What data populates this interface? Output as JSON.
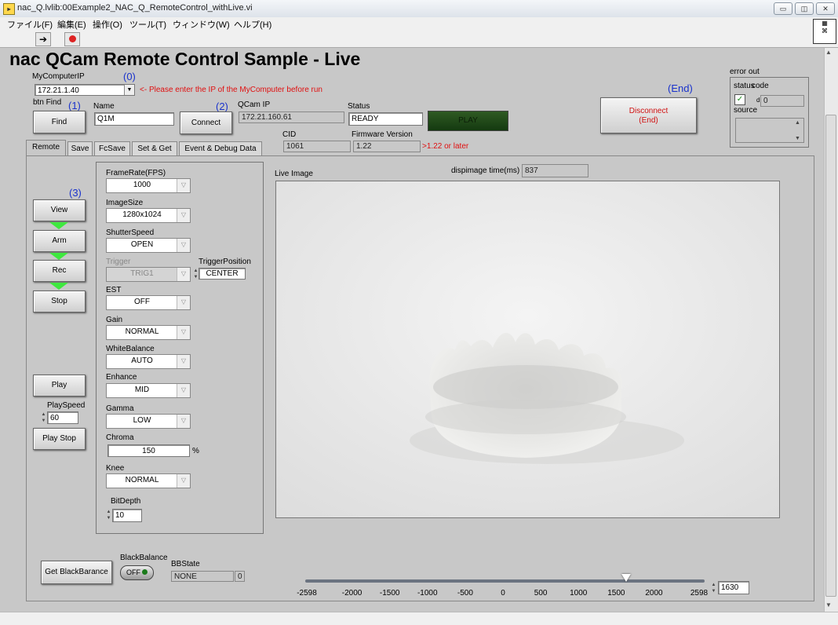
{
  "window": {
    "title": "nac_Q.lvlib:00Example2_NAC_Q_RemoteControl_withLive.vi"
  },
  "menu": [
    "ファイル(F)",
    "編集(E)",
    "操作(O)",
    "ツール(T)",
    "ウィンドウ(W)",
    "ヘルプ(H)"
  ],
  "page_title": "nac QCam Remote Control Sample - Live",
  "steps": {
    "s0": "(0)",
    "s1": "(1)",
    "s2": "(2)",
    "s3": "(3)",
    "end": "(End)"
  },
  "connection": {
    "my_ip_label": "MyComputerIP",
    "my_ip_value": "172.21.1.40",
    "ip_hint": "<- Please enter the IP of the MyComputer before run",
    "btn_find_label": "btn Find",
    "find_button": "Find",
    "name_label": "Name",
    "name_value": "Q1M",
    "connect_button": "Connect",
    "qcam_ip_label": "QCam IP",
    "qcam_ip_value": "172.21.160.61",
    "status_label": "Status",
    "status_value": "READY",
    "play_indicator": "PLAY",
    "cid_label": "CID",
    "cid_value": "1061",
    "fw_label": "Firmware Version",
    "fw_value": "1.22",
    "fw_hint": ">1.22 or later",
    "disconnect_line1": "Disconnect",
    "disconnect_line2": "(End)"
  },
  "error_out": {
    "label": "error out",
    "status_label": "status",
    "code_label": "code",
    "code_value": "0",
    "code_prefix": "d",
    "source_label": "source"
  },
  "tabs": [
    "Remote",
    "Save",
    "FcSave",
    "Set & Get",
    "Event & Debug Data"
  ],
  "remote": {
    "view": "View",
    "arm": "Arm",
    "rec": "Rec",
    "stop": "Stop",
    "play": "Play",
    "play_speed_label": "PlaySpeed",
    "play_speed_value": "60",
    "play_stop": "Play Stop"
  },
  "settings": {
    "framerate_label": "FrameRate(FPS)",
    "framerate": "1000",
    "imagesize_label": "ImageSize",
    "imagesize": "1280x1024",
    "shutter_label": "ShutterSpeed",
    "shutter": "OPEN",
    "trigger_label": "Trigger",
    "trigger": "TRIG1",
    "trigpos_label": "TriggerPosition",
    "trigpos": "CENTER",
    "est_label": "EST",
    "est": "OFF",
    "gain_label": "Gain",
    "gain": "NORMAL",
    "wb_label": "WhiteBalance",
    "wb": "AUTO",
    "enhance_label": "Enhance",
    "enhance": "MID",
    "gamma_label": "Gamma",
    "gamma": "LOW",
    "chroma_label": "Chroma",
    "chroma": "150",
    "chroma_unit": "%",
    "knee_label": "Knee",
    "knee": "NORMAL",
    "bitdepth_label": "BitDepth",
    "bitdepth": "10"
  },
  "live": {
    "label": "Live Image",
    "dispimage_label": "dispimage time(ms)",
    "dispimage_value": "837"
  },
  "blackbalance": {
    "get_button": "Get BlackBarance",
    "bb_label": "BlackBalance",
    "bb_switch": "OFF",
    "bbstate_label": "BBState",
    "bbstate_value": "NONE",
    "bbstate_num": "0"
  },
  "slider": {
    "ticks": [
      "-2598",
      "-2000",
      "-1500",
      "-1000",
      "-500",
      "0",
      "500",
      "1000",
      "1500",
      "2000",
      "2598"
    ],
    "min": -2598,
    "max": 2598,
    "value": "1630"
  }
}
